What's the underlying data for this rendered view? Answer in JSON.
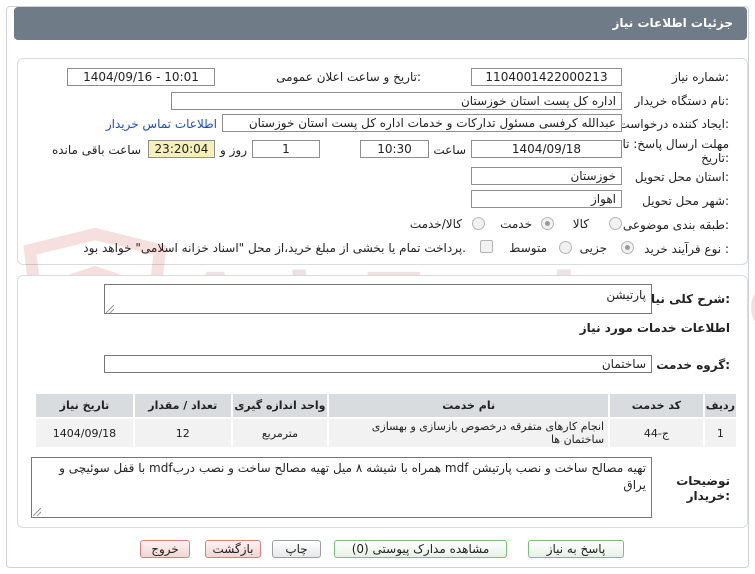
{
  "window": {
    "title": "جزئیات اطلاعات نیاز"
  },
  "form": {
    "need_number_label": "شماره نیاز:",
    "need_number": "1104001422000213",
    "announce_label": "تاریخ و ساعت اعلان عمومی:",
    "announce_value": "1404/09/16 - 10:01",
    "buyer_org_label": "نام دستگاه خریدار:",
    "buyer_org": "اداره کل پست استان خوزستان",
    "creator_label": "ایجاد کننده درخواست:",
    "creator": "عبدالله کرفسی مسئول تدارکات و خدمات اداره کل پست استان خوزستان",
    "contact_link": "اطلاعات تماس خریدار",
    "deadline_label_1": "مهلت ارسال پاسخ: تا",
    "deadline_label_2": "تاریخ:",
    "deadline_date": "1404/09/18",
    "time_label": "ساعت",
    "deadline_time": "10:30",
    "days_value": "1",
    "days_label": "روز و",
    "remaining_time": "23:20:04",
    "remaining_label": "ساعت باقی مانده",
    "province_label": "استان محل تحویل:",
    "province": "خوزستان",
    "city_label": "شهر محل تحویل:",
    "city": "اهواز",
    "category_label": "طبقه بندی موضوعی:",
    "category_options": [
      "کالا",
      "خدمت",
      "کالا/خدمت"
    ],
    "category_selected": "خدمت",
    "process_label": "نوع فرآیند خرید :",
    "process_options": [
      "جزیی",
      "متوسط"
    ],
    "process_selected": "جزیی",
    "payment_note": "پرداخت تمام یا بخشی از مبلغ خرید،از محل \"اسناد خزانه اسلامی\" خواهد بود."
  },
  "summary": {
    "label": "شرح کلی نیاز:",
    "value": "پارتیشن"
  },
  "services": {
    "heading": "اطلاعات خدمات مورد نیاز",
    "group_label": "گروه خدمت:",
    "group_value": "ساختمان",
    "columns": [
      "ردیف",
      "کد خدمت",
      "نام خدمت",
      "واحد اندازه گیری",
      "تعداد / مقدار",
      "تاریخ نیاز"
    ],
    "rows": [
      {
        "index": "1",
        "code": "ج-44",
        "name": "انجام کارهای متفرقه درخصوص بازسازی و بهسازی ساختمان ها",
        "unit": "مترمربع",
        "quantity": "12",
        "date": "1404/09/18"
      }
    ]
  },
  "buyer_notes": {
    "label_1": "توضیحات",
    "label_2": "خریدار:",
    "value": "تهیه مصالح ساخت و نصب پارتیشن mdf همراه با شیشه ۸ میل تهیه مصالح ساخت و نصب دربmdf با قفل سوئیچی و یراق"
  },
  "buttons": {
    "reply": "پاسخ به نیاز",
    "attachments": "مشاهده مدارک پیوستی (0)",
    "print": "چاپ",
    "back": "بازگشت",
    "exit": "خروج"
  },
  "watermark": {
    "text": "AriaTender.neT"
  },
  "colors": {
    "titlebar": "#6f7b87",
    "link": "#1a4fc4",
    "remaining_bg": "#f5f0b8",
    "table_header": "#d9dcdf"
  }
}
